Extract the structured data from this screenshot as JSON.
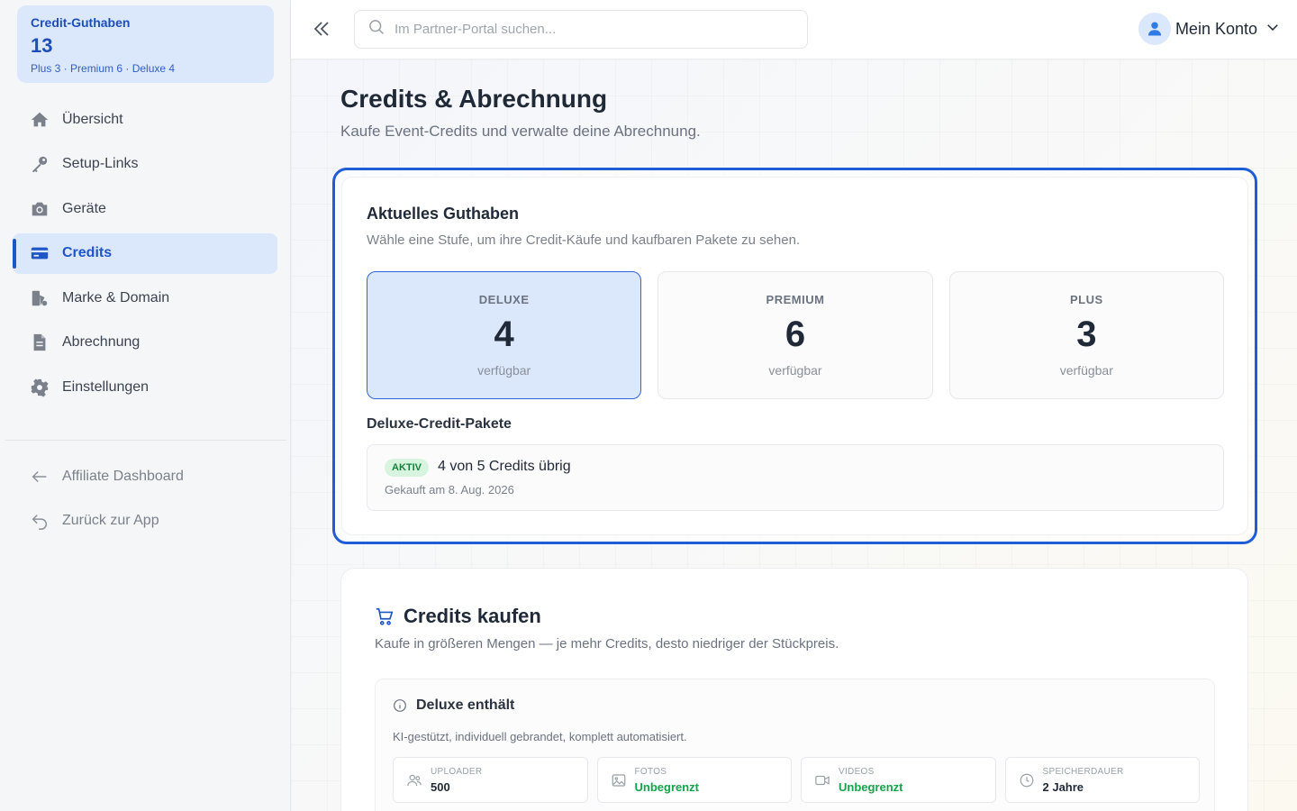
{
  "sidebar": {
    "credit_card": {
      "title": "Credit-Guthaben",
      "total": "13",
      "breakdown": "Plus 3 · Premium 6 · Deluxe 4"
    },
    "items": [
      {
        "label": "Übersicht",
        "icon": "home-icon"
      },
      {
        "label": "Setup-Links",
        "icon": "key-icon"
      },
      {
        "label": "Geräte",
        "icon": "camera-icon"
      },
      {
        "label": "Credits",
        "icon": "credit-card-icon",
        "active": true
      },
      {
        "label": "Marke & Domain",
        "icon": "brand-icon"
      },
      {
        "label": "Abrechnung",
        "icon": "document-icon"
      },
      {
        "label": "Einstellungen",
        "icon": "gear-icon"
      }
    ],
    "secondary": [
      {
        "label": "Affiliate Dashboard",
        "icon": "arrow-left-icon"
      },
      {
        "label": "Zurück zur App",
        "icon": "undo-icon"
      }
    ]
  },
  "header": {
    "search_placeholder": "Im Partner-Portal suchen...",
    "account_label": "Mein Konto"
  },
  "main": {
    "title": "Credits & Abrechnung",
    "subtitle": "Kaufe Event-Credits und verwalte deine Abrechnung.",
    "balance": {
      "title": "Aktuelles Guthaben",
      "subtitle": "Wähle eine Stufe, um ihre Credit-Käufe und kaufbaren Pakete zu sehen.",
      "tiers": [
        {
          "name": "DELUXE",
          "count": "4",
          "label": "verfügbar",
          "selected": true
        },
        {
          "name": "PREMIUM",
          "count": "6",
          "label": "verfügbar"
        },
        {
          "name": "PLUS",
          "count": "3",
          "label": "verfügbar"
        }
      ],
      "packages_title": "Deluxe-Credit-Pakete",
      "package": {
        "badge": "AKTIV",
        "text": "4 von 5 Credits übrig",
        "date": "Gekauft am 8. Aug. 2026"
      }
    },
    "buy": {
      "title": "Credits kaufen",
      "subtitle": "Kaufe in größeren Mengen — je mehr Credits, desto niedriger der Stückpreis.",
      "includes": {
        "title": "Deluxe enthält",
        "subtitle": "KI-gestützt, individuell gebrandet, komplett automatisiert.",
        "features": [
          {
            "label": "UPLOADER",
            "value": "500",
            "icon": "users-icon"
          },
          {
            "label": "FOTOS",
            "value": "Unbegrenzt",
            "icon": "image-icon",
            "accent": true
          },
          {
            "label": "VIDEOS",
            "value": "Unbegrenzt",
            "icon": "video-icon",
            "accent": true
          },
          {
            "label": "SPEICHERDAUER",
            "value": "2 Jahre",
            "icon": "clock-icon"
          }
        ]
      }
    }
  },
  "colors": {
    "accent": "#1e56c7",
    "active_bg": "#dbe7fb",
    "success": "#16a34a"
  }
}
